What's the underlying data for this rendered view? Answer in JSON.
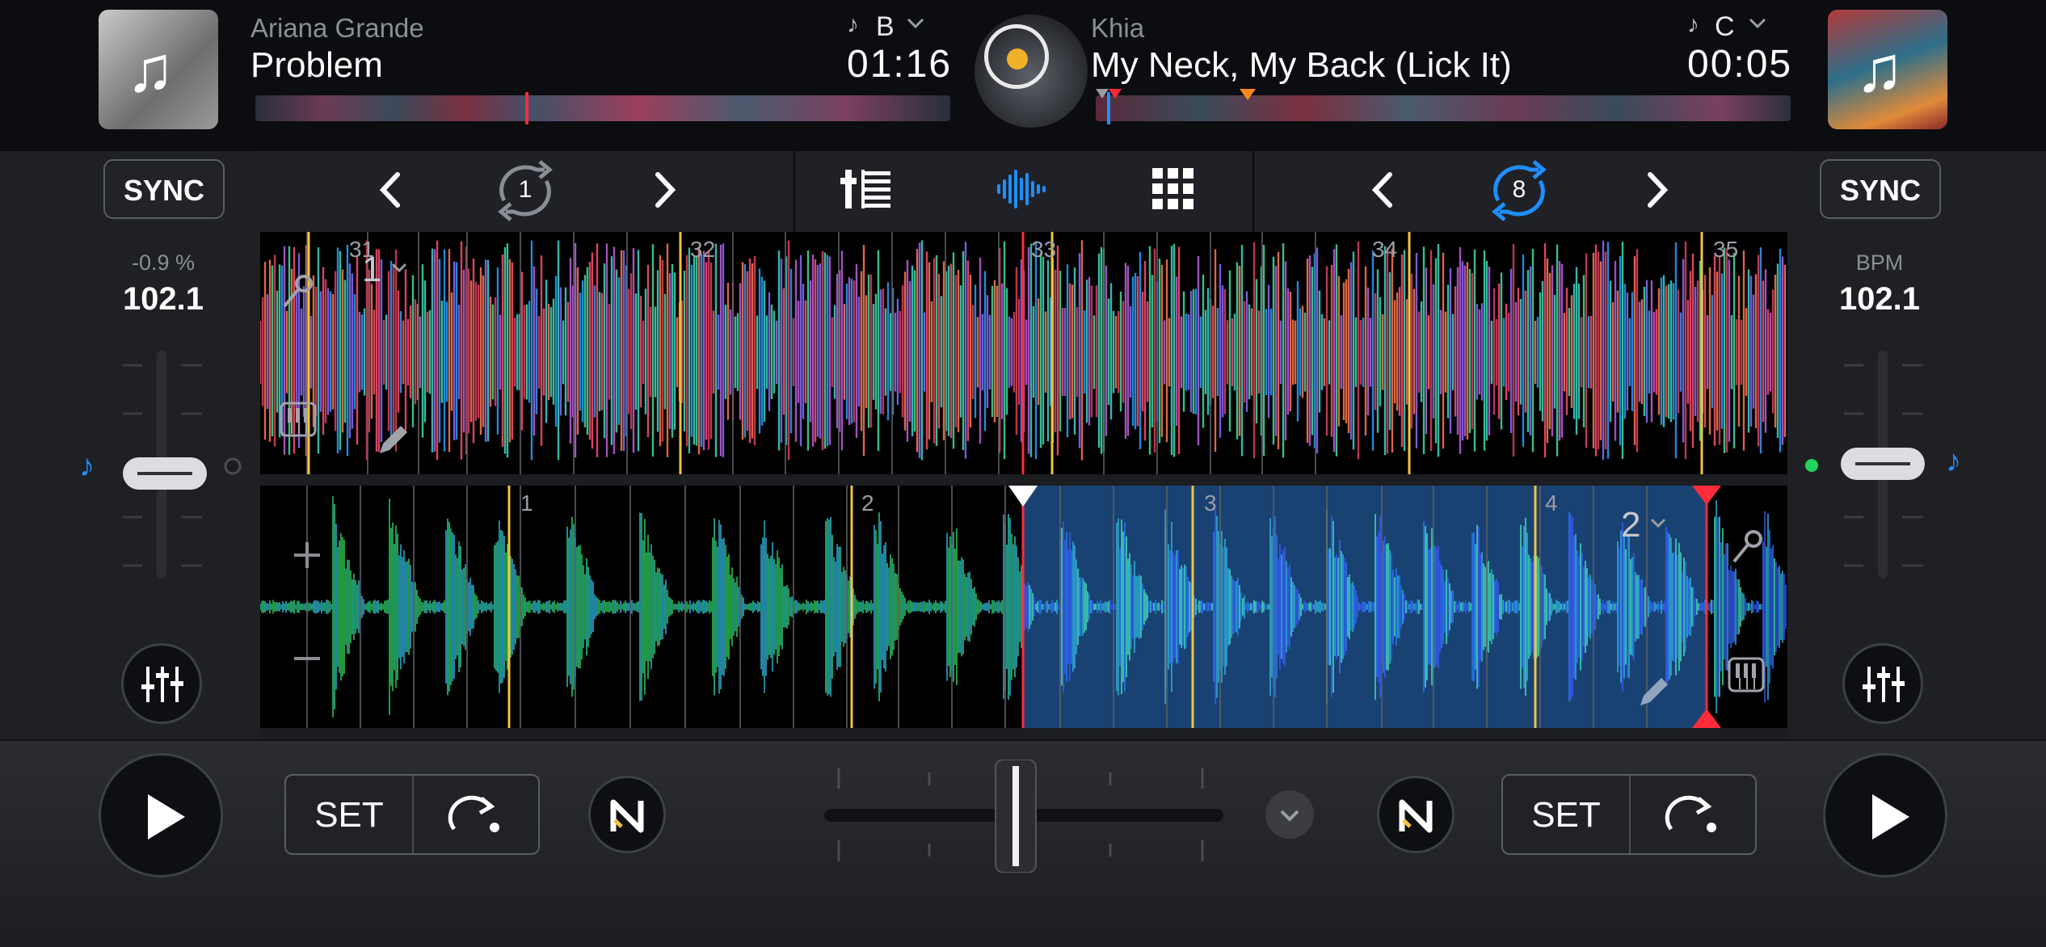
{
  "deck_a": {
    "artist": "Ariana Grande",
    "title": "Problem",
    "key": "B",
    "time": "01:16",
    "sync_label": "SYNC",
    "pitch_label": "-0.9 %",
    "bpm": "102.1",
    "loop_size": "1",
    "beat_numbers": [
      "31",
      "32",
      "33",
      "34",
      "35"
    ],
    "hotcue_bank": "1",
    "set_label": "SET"
  },
  "deck_b": {
    "artist": "Khia",
    "title": "My Neck, My Back (Lick It)",
    "key": "C",
    "time": "00:05",
    "sync_label": "SYNC",
    "pitch_label": "BPM",
    "bpm": "102.1",
    "loop_size": "8",
    "beat_numbers": [
      "1",
      "2",
      "3",
      "4"
    ],
    "hotcue_bank": "2",
    "set_label": "SET"
  },
  "colors": {
    "accent": "#1e8fff",
    "loop_region": "#1d4e86",
    "playhead": "#ff2a3a",
    "bar_marker": "#f3c33c"
  },
  "icons": [
    "music-note-icon",
    "chevron-down-icon",
    "chevron-left-icon",
    "chevron-right-icon",
    "loop-icon",
    "mixer-icon",
    "waveform-icon",
    "pads-grid-icon",
    "microphone-icon",
    "piano-icon",
    "pencil-icon",
    "plus-icon",
    "minus-icon",
    "eq-settings-icon",
    "play-icon",
    "cue-jump-icon",
    "neural-mix-icon",
    "record-icon"
  ]
}
